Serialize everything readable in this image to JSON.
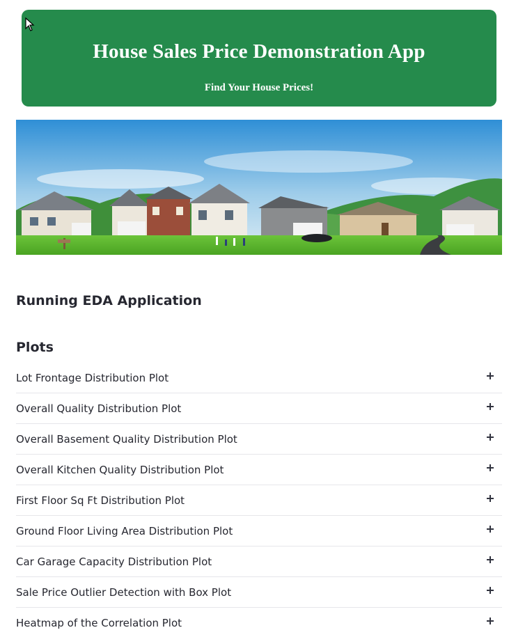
{
  "banner": {
    "title": "House Sales Price Demonstration App",
    "subtitle": "Find Your House Prices!",
    "background_color": "#258b4c"
  },
  "hero_image": {
    "description_icon": "suburban-houses-illustration"
  },
  "sections": {
    "eda_heading": "Running EDA Application",
    "plots_heading": "Plots"
  },
  "expanders": [
    {
      "label": "Lot Frontage Distribution Plot",
      "icon": "plus-icon"
    },
    {
      "label": "Overall Quality Distribution Plot",
      "icon": "plus-icon"
    },
    {
      "label": "Overall Basement Quality Distribution Plot",
      "icon": "plus-icon"
    },
    {
      "label": "Overall Kitchen Quality Distribution Plot",
      "icon": "plus-icon"
    },
    {
      "label": "First Floor Sq Ft Distribution Plot",
      "icon": "plus-icon"
    },
    {
      "label": "Ground Floor Living Area Distribution Plot",
      "icon": "plus-icon"
    },
    {
      "label": "Car Garage Capacity Distribution Plot",
      "icon": "plus-icon"
    },
    {
      "label": "Sale Price Outlier Detection with Box Plot",
      "icon": "plus-icon"
    },
    {
      "label": "Heatmap of the Correlation Plot",
      "icon": "plus-icon"
    }
  ]
}
